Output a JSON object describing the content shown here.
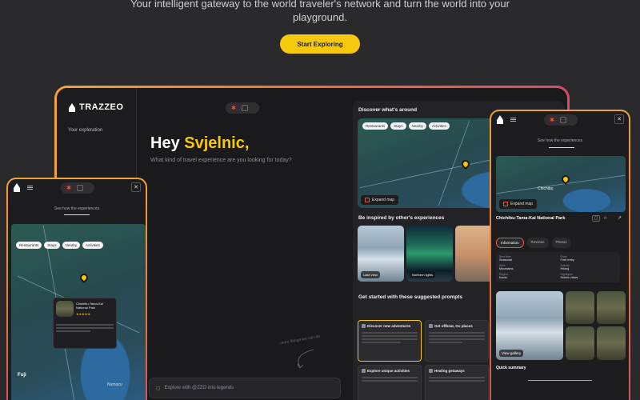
{
  "hero": {
    "subtitle": "Your intelligent gateway to the world traveler's network and turn the world into your playground.",
    "cta": "Start Exploring"
  },
  "app": {
    "brand": "TRAZZEO",
    "sidebar_item": "Your exploration",
    "greeting_prefix": "Hey ",
    "greeting_name": "Svjelnic,",
    "greeting_question": "What kind of travel experience are you looking for today?",
    "doodle_note": "more things we can do",
    "explore_placeholder": "Explore with @ZZO into legends"
  },
  "right_panel": {
    "discover_title": "Discover what's around",
    "map_chips": [
      "Restaurants",
      "Stays",
      "Nearby",
      "Activities"
    ],
    "expand_map": "Expand map",
    "inspired_title": "Be inspired by other's experiences",
    "inspired_photos": [
      {
        "caption": "Lake view"
      },
      {
        "caption": "Northern lights"
      },
      {
        "caption": ""
      }
    ],
    "prompts_title": "Get started with these suggested prompts",
    "prompts": [
      {
        "title": "Discover new adventures",
        "active": true
      },
      {
        "title": "Get offbeat, Go places",
        "active": false
      },
      {
        "title": "",
        "active": false
      },
      {
        "title": "Explore unique activities",
        "active": false
      },
      {
        "title": "Healing getaways",
        "active": false
      },
      {
        "title": "",
        "active": false
      }
    ]
  },
  "left_phone": {
    "subtitle": "See how the experiences",
    "chips": [
      "Restaurants",
      "Stays",
      "Nearby",
      "Activities"
    ],
    "map_label_1": "Fuji",
    "map_label_2": "Numazu",
    "card_title": "Chichibu-Tama-Kai National Park",
    "card_rating": "★★★★★"
  },
  "right_phone": {
    "subtitle": "See how the experiences",
    "map_label": "Chichibu",
    "expand_map": "Expand map",
    "place_title": "Chichibu-Tama-Kai National Park",
    "tabs": [
      "Information",
      "Reviews",
      "Photos"
    ],
    "info": [
      {
        "label": "Best time",
        "value": "Seasonal"
      },
      {
        "label": "Entry",
        "value": "Free entry"
      },
      {
        "label": "Area",
        "value": "Mountains"
      },
      {
        "label": "Activity",
        "value": "Hiking"
      },
      {
        "label": "Region",
        "value": "Kanto"
      },
      {
        "label": "Highlights",
        "value": "Scenic views"
      }
    ],
    "photo_btn": "View gallery",
    "footer_title": "Quick summary"
  },
  "colors": {
    "accent_yellow": "#f6c90e",
    "accent_orange": "#e8743a",
    "background": "#2a292c"
  }
}
